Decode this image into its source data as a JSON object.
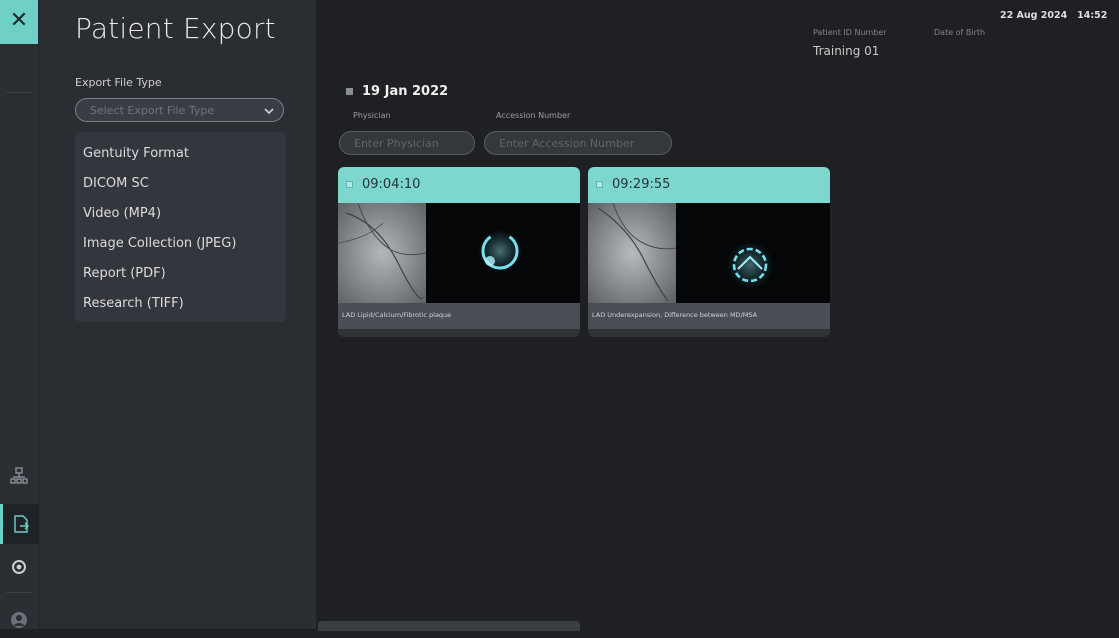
{
  "header": {
    "title": "Patient Export",
    "patient_id_label": "Patient ID Number",
    "dob_label": "Date of Birth",
    "patient_id_value": "Training 01",
    "date": "22 Aug 2024",
    "time": "14:52"
  },
  "export": {
    "label": "Export File Type",
    "placeholder": "Select Export File Type",
    "options": [
      "Gentuity Format",
      "DICOM SC",
      "Video (MP4)",
      "Image Collection (JPEG)",
      "Report (PDF)",
      "Research (TIFF)"
    ]
  },
  "study": {
    "date": "19 Jan 2022",
    "physician_label": "Physician",
    "physician_placeholder": "Enter Physician",
    "accession_label": "Accession Number",
    "accession_placeholder": "Enter Accession Number"
  },
  "recordings": [
    {
      "time": "09:04:10",
      "caption": "LAD Lipid/Calcium/Fibrotic plaque"
    },
    {
      "time": "09:29:55",
      "caption": "LAD Underexpansion, Difference between MD/MSA"
    }
  ],
  "colors": {
    "accent": "#7dd7cf",
    "background": "#1e2024",
    "panel": "#2a2d32"
  },
  "icons": {
    "close": "close-icon",
    "network": "network-icon",
    "export": "export-icon",
    "settings": "settings-icon",
    "user": "user-icon"
  }
}
